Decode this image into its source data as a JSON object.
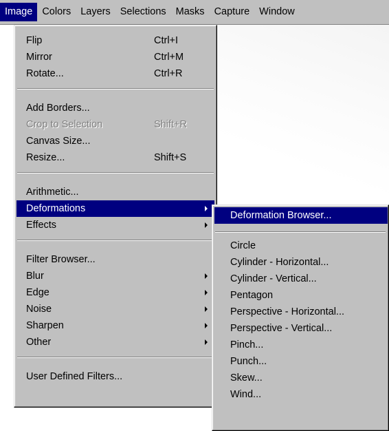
{
  "menubar": {
    "items": [
      {
        "label": "Image",
        "active": true
      },
      {
        "label": "Colors"
      },
      {
        "label": "Layers"
      },
      {
        "label": "Selections"
      },
      {
        "label": "Masks"
      },
      {
        "label": "Capture"
      },
      {
        "label": "Window"
      }
    ]
  },
  "image_menu": {
    "items": [
      {
        "label": "Flip",
        "shortcut": "Ctrl+I"
      },
      {
        "label": "Mirror",
        "shortcut": "Ctrl+M"
      },
      {
        "label": "Rotate...",
        "shortcut": "Ctrl+R"
      },
      {
        "label": "Add Borders..."
      },
      {
        "label": "Crop to Selection",
        "shortcut": "Shift+R",
        "disabled": true
      },
      {
        "label": "Canvas Size..."
      },
      {
        "label": "Resize...",
        "shortcut": "Shift+S"
      },
      {
        "label": "Arithmetic..."
      },
      {
        "label": "Deformations",
        "submenu": true,
        "highlighted": true
      },
      {
        "label": "Effects",
        "submenu": true
      },
      {
        "label": "Filter Browser..."
      },
      {
        "label": "Blur",
        "submenu": true
      },
      {
        "label": "Edge",
        "submenu": true
      },
      {
        "label": "Noise",
        "submenu": true
      },
      {
        "label": "Sharpen",
        "submenu": true
      },
      {
        "label": "Other",
        "submenu": true
      },
      {
        "label": "User Defined Filters..."
      }
    ]
  },
  "deformations_menu": {
    "items": [
      {
        "label": "Deformation Browser...",
        "highlighted": true
      },
      {
        "label": "Circle"
      },
      {
        "label": "Cylinder - Horizontal..."
      },
      {
        "label": "Cylinder - Vertical..."
      },
      {
        "label": "Pentagon"
      },
      {
        "label": "Perspective - Horizontal..."
      },
      {
        "label": "Perspective - Vertical..."
      },
      {
        "label": "Pinch..."
      },
      {
        "label": "Punch..."
      },
      {
        "label": "Skew..."
      },
      {
        "label": "Wind..."
      }
    ]
  },
  "colors": {
    "menu_face": "#c0c0c0",
    "highlight": "#000080",
    "disabled_text": "#808080"
  }
}
